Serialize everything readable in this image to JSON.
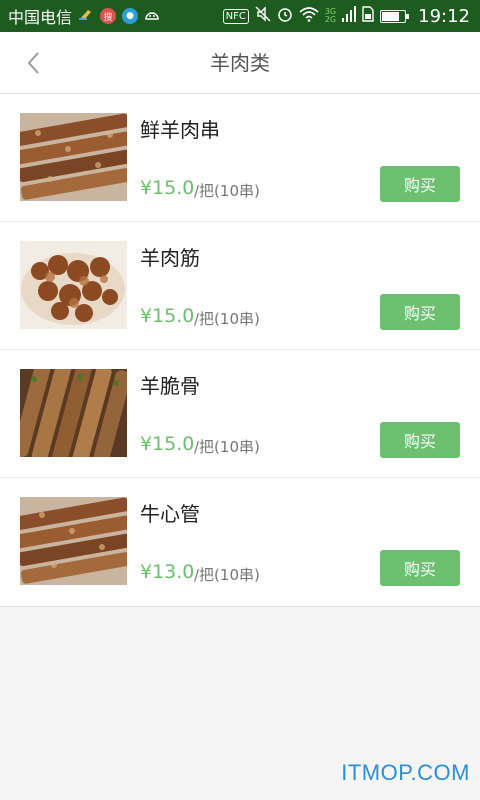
{
  "status_bar": {
    "carrier": "中国电信",
    "nfc_label": "NFC",
    "network_top": "3G",
    "network_bottom": "2G",
    "time": "19:12",
    "battery_level_percent": 80,
    "icons": [
      "cleaner-icon",
      "app-badge-icon",
      "app-badge-icon",
      "android-icon",
      "nfc-icon",
      "mute-icon",
      "alarm-icon",
      "wifi-icon",
      "signal-icon",
      "sim-icon",
      "battery-icon"
    ]
  },
  "header": {
    "title": "羊肉类",
    "back_icon": "chevron-left-icon"
  },
  "products": [
    {
      "name": "鲜羊肉串",
      "price": "¥15.0",
      "unit": "/把(10串)",
      "button": "购买"
    },
    {
      "name": "羊肉筋",
      "price": "¥15.0",
      "unit": "/把(10串)",
      "button": "购买"
    },
    {
      "name": "羊脆骨",
      "price": "¥15.0",
      "unit": "/把(10串)",
      "button": "购买"
    },
    {
      "name": "牛心管",
      "price": "¥13.0",
      "unit": "/把(10串)",
      "button": "购买"
    }
  ],
  "watermark": "ITMOP.COM",
  "colors": {
    "status_bar": "#1d5b1f",
    "price": "#6cbf6a",
    "button": "#6cc06f",
    "watermark": "#2b8fd6"
  }
}
